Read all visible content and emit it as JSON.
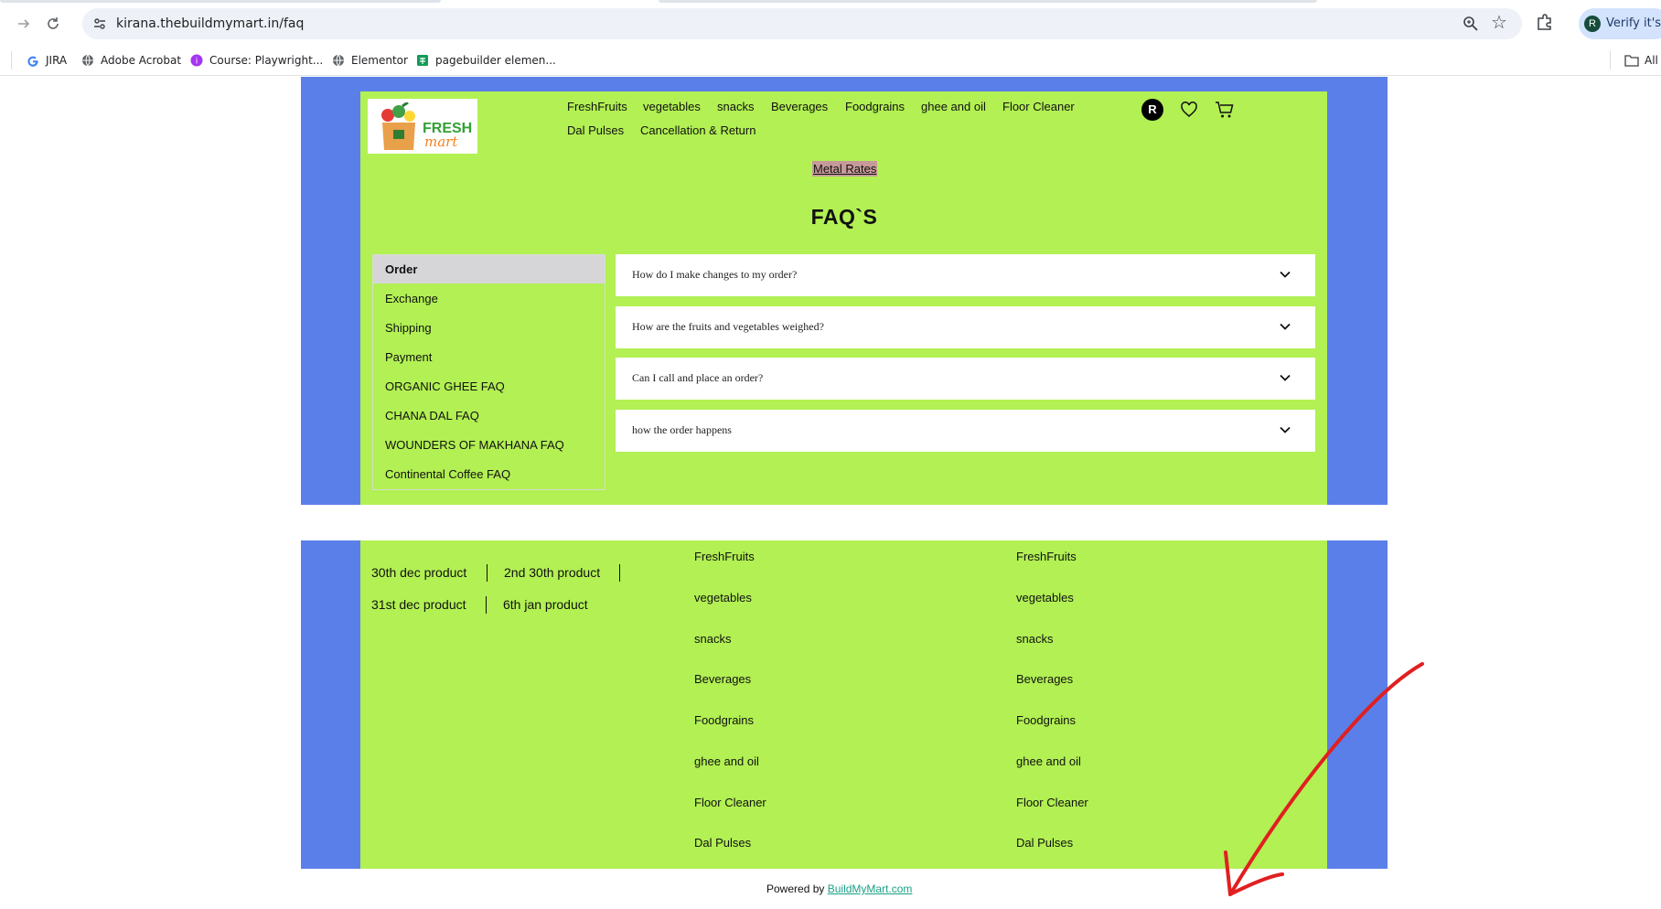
{
  "browser": {
    "url": "kirana.thebuildmymart.in/faq",
    "profile_initial": "R",
    "profile_text": "Verify it's y",
    "bookmarks": [
      "JIRA",
      "Adobe Acrobat",
      "Course: Playwright...",
      "Elementor",
      "pagebuilder elemen...",
      "All"
    ],
    "colors": {
      "omnibox_bg": "#eef1f7",
      "profile_bg": "#d3e3fd"
    }
  },
  "header": {
    "logo": {
      "line1": "FRESH",
      "line2": "mart"
    },
    "nav": [
      "FreshFruits",
      "vegetables",
      "snacks",
      "Beverages",
      "Foodgrains",
      "ghee and oil",
      "Floor Cleaner",
      "Dal Pulses",
      "Cancellation & Return"
    ],
    "user_initial": "R",
    "metal_rates": "Metal Rates"
  },
  "page": {
    "title": "FAQ`S",
    "categories": [
      "Order",
      "Exchange",
      "Shipping",
      "Payment",
      "ORGANIC GHEE FAQ",
      "CHANA DAL FAQ",
      "WOUNDERS OF MAKHANA FAQ",
      "Continental Coffee FAQ"
    ],
    "active_category": "Order",
    "questions": [
      "How do I make changes to my order?",
      "How are the fruits and vegetables weighed?",
      "Can I call and place an order?",
      "how the order happens"
    ]
  },
  "footer": {
    "product_links": [
      "30th dec product",
      "2nd 30th product",
      "31st dec product",
      "6th jan product"
    ],
    "col1": [
      "FreshFruits",
      "vegetables",
      "snacks",
      "Beverages",
      "Foodgrains",
      "ghee and oil",
      "Floor Cleaner",
      "Dal Pulses"
    ],
    "col2": [
      "FreshFruits",
      "vegetables",
      "snacks",
      "Beverages",
      "Foodgrains",
      "ghee and oil",
      "Floor Cleaner",
      "Dal Pulses"
    ],
    "powered_prefix": "Powered by",
    "powered_link": "BuildMyMart.com"
  },
  "colors": {
    "band_blue": "#5b7fe8",
    "panel_green": "#b2f053",
    "annotation_red": "#e02020",
    "active_item": "#d6d6d9"
  }
}
